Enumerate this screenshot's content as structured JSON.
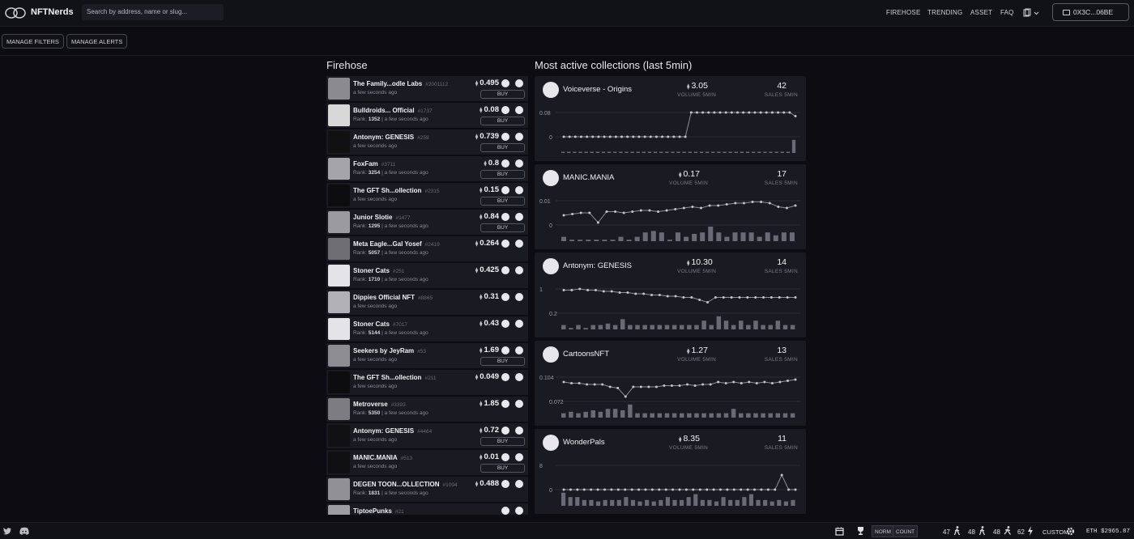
{
  "app": {
    "brand": "NFTNerds"
  },
  "search": {
    "placeholder": "Search by address, name or slug..."
  },
  "nav": {
    "firehose": "FIREHOSE",
    "trending": "TRENDING",
    "asset": "ASSET",
    "faq": "FAQ"
  },
  "wallet": {
    "address": "0X3C...06BE"
  },
  "actions": {
    "manage_filters": "MANAGE FILTERS",
    "manage_alerts": "MANAGE ALERTS"
  },
  "firehose": {
    "title": "Firehose",
    "buy_label": "BUY",
    "rank_prefix": "Rank:",
    "rows": [
      {
        "name": "The Family...odle Labs",
        "id": "#2001112",
        "rank": "",
        "time": "a few seconds ago",
        "price": "0.495",
        "buy": true,
        "thumb": "#8a8a90"
      },
      {
        "name": "Bulldroids... Official",
        "id": "#1737",
        "rank": "1352",
        "time": "a few seconds ago",
        "price": "0.08",
        "buy": true,
        "thumb": "#d8d8d8"
      },
      {
        "name": "Antonym: GENESIS",
        "id": "#258",
        "rank": "",
        "time": "a few seconds ago",
        "price": "0.739",
        "buy": true,
        "thumb": "#111114"
      },
      {
        "name": "FoxFam",
        "id": "#3711",
        "rank": "3254",
        "time": "a few seconds ago",
        "price": "0.8",
        "buy": true,
        "thumb": "#a4a4aa"
      },
      {
        "name": "The GFT Sh...ollection",
        "id": "#2315",
        "rank": "",
        "time": "a few seconds ago",
        "price": "0.15",
        "buy": true,
        "thumb": "#0d0d10"
      },
      {
        "name": "Junior Slotie",
        "id": "#1477",
        "rank": "1295",
        "time": "a few seconds ago",
        "price": "0.84",
        "buy": true,
        "thumb": "#9a9aa0"
      },
      {
        "name": "Meta Eagle...Gal Yosef",
        "id": "#2419",
        "rank": "5057",
        "time": "a few seconds ago",
        "price": "0.264",
        "buy": false,
        "thumb": "#6e6e74"
      },
      {
        "name": "Stoner Cats",
        "id": "#251",
        "rank": "1710",
        "time": "a few seconds ago",
        "price": "0.425",
        "buy": false,
        "thumb": "#e4e4e8"
      },
      {
        "name": "Dippies Official NFT",
        "id": "#8865",
        "rank": "",
        "time": "a few seconds ago",
        "price": "0.31",
        "buy": false,
        "thumb": "#b0b0b6"
      },
      {
        "name": "Stoner Cats",
        "id": "#7017",
        "rank": "5144",
        "time": "a few seconds ago",
        "price": "0.43",
        "buy": false,
        "thumb": "#e4e4e8"
      },
      {
        "name": "Seekers by JeyRam",
        "id": "#53",
        "rank": "",
        "time": "a few seconds ago",
        "price": "1.69",
        "buy": true,
        "thumb": "#8c8c92"
      },
      {
        "name": "The GFT Sh...ollection",
        "id": "#211",
        "rank": "",
        "time": "a few seconds ago",
        "price": "0.049",
        "buy": false,
        "thumb": "#0d0d10"
      },
      {
        "name": "Metroverse",
        "id": "#3393",
        "rank": "5350",
        "time": "a few seconds ago",
        "price": "1.85",
        "buy": false,
        "thumb": "#7c7c82"
      },
      {
        "name": "Antonym: GENESIS",
        "id": "#4464",
        "rank": "",
        "time": "a few seconds ago",
        "price": "0.72",
        "buy": true,
        "thumb": "#111114"
      },
      {
        "name": "MANIC.MANIA",
        "id": "#513",
        "rank": "",
        "time": "a few seconds ago",
        "price": "0.01",
        "buy": true,
        "thumb": "#0f0f12"
      },
      {
        "name": "DEGEN TOON...OLLECTION",
        "id": "#1094",
        "rank": "1831",
        "time": "a few seconds ago",
        "price": "0.488",
        "buy": false,
        "thumb": "#909096"
      },
      {
        "name": "TiptoePunks",
        "id": "#21",
        "rank": "",
        "time": "",
        "price": "",
        "buy": false,
        "thumb": "#9c9ca2"
      }
    ]
  },
  "collections": {
    "title": "Most active collections (last 5min)",
    "volume_label": "VOLUME 5MIN",
    "sales_label": "SALES 5MIN",
    "cards": [
      {
        "name": "Voiceverse - Origins",
        "volume": "3.05",
        "sales": "42",
        "ytop": "0.08",
        "ybottom": "0",
        "line": [
          0,
          0,
          0,
          0,
          0,
          0,
          0,
          0,
          0,
          0,
          0,
          0,
          0,
          0,
          0,
          0,
          0,
          0,
          0,
          0,
          0,
          0,
          1,
          1,
          1,
          1,
          1,
          1,
          1,
          1,
          1,
          1,
          1,
          1,
          1,
          1,
          1,
          1,
          1,
          1,
          0.85
        ],
        "bars": [
          0.05,
          0.05,
          0.05,
          0.05,
          0.05,
          0.05,
          0.05,
          0.05,
          0.05,
          0.05,
          0.05,
          0.05,
          0.05,
          0.05,
          0.05,
          0.05,
          0.05,
          0.05,
          0.05,
          0.05,
          0.05,
          0.05,
          0.05,
          0.05,
          0.05,
          0.05,
          0.05,
          0.05,
          0.05,
          0.05,
          0.05,
          0.05,
          0.05,
          0.05,
          0.05,
          0.05,
          0.05,
          0.05,
          0.05,
          0.05,
          0.9
        ]
      },
      {
        "name": "MANIC.MANIA",
        "volume": "0.17",
        "sales": "17",
        "ytop": "0.01",
        "ybottom": "0",
        "line": [
          0.4,
          0.45,
          0.5,
          0.5,
          0.1,
          0.55,
          0.55,
          0.5,
          0.55,
          0.6,
          0.6,
          0.55,
          0.6,
          0.65,
          0.7,
          0.75,
          0.7,
          0.8,
          0.8,
          0.85,
          0.9,
          0.9,
          0.95,
          0.95,
          0.9,
          0.75,
          0.7,
          0.8
        ],
        "bars": [
          0.3,
          0.1,
          0.1,
          0.1,
          0.1,
          0.1,
          0.1,
          0.3,
          0.1,
          0.3,
          0.6,
          0.7,
          0.6,
          0.1,
          0.6,
          0.3,
          0.5,
          0.6,
          1.0,
          0.6,
          0.3,
          0.6,
          0.6,
          0.6,
          0.3,
          0.6,
          0.4,
          0.6,
          0.6
        ]
      },
      {
        "name": "Antonym: GENESIS",
        "volume": "10.30",
        "sales": "14",
        "ytop": "1",
        "ybottom": "0.2",
        "line": [
          0.95,
          0.95,
          1.0,
          0.95,
          0.95,
          0.9,
          0.9,
          0.85,
          0.85,
          0.8,
          0.8,
          0.75,
          0.75,
          0.7,
          0.7,
          0.65,
          0.65,
          0.55,
          0.45,
          0.65,
          0.65,
          0.65,
          0.65,
          0.65,
          0.65,
          0.65,
          0.65,
          0.65,
          0.65,
          0.65
        ],
        "bars": [
          0.3,
          0.1,
          0.3,
          0.1,
          0.3,
          0.3,
          0.4,
          0.3,
          0.7,
          0.3,
          0.3,
          0.3,
          0.3,
          0.3,
          0.3,
          0.3,
          0.3,
          0.3,
          0.3,
          0.6,
          0.3,
          0.9,
          0.6,
          0.3,
          0.6,
          0.3,
          0.6,
          0.3,
          0.3,
          0.6,
          0.3,
          0.3
        ]
      },
      {
        "name": "CartoonsNFT",
        "volume": "1.27",
        "sales": "13",
        "ytop": "0.104",
        "ybottom": "0.072",
        "line": [
          0.8,
          0.75,
          0.75,
          0.7,
          0.7,
          0.7,
          0.6,
          0.55,
          0.2,
          0.6,
          0.6,
          0.6,
          0.6,
          0.65,
          0.65,
          0.65,
          0.7,
          0.65,
          0.7,
          0.7,
          0.8,
          0.75,
          0.8,
          0.75,
          0.8,
          0.75,
          0.8,
          0.75,
          0.8,
          0.85,
          0.9
        ],
        "bars": [
          0.3,
          0.4,
          0.3,
          0.4,
          0.5,
          0.4,
          0.6,
          0.6,
          0.5,
          0.9,
          0.3,
          0.3,
          0.3,
          0.3,
          0.3,
          0.3,
          0.3,
          0.3,
          0.3,
          0.3,
          0.3,
          0.3,
          0.3,
          0.6,
          0.3,
          0.3,
          0.3,
          0.3,
          0.3,
          0.3,
          0.3,
          0.3
        ]
      },
      {
        "name": "WonderPals",
        "volume": "8.35",
        "sales": "11",
        "ytop": "8",
        "ybottom": "0",
        "line": [
          0,
          0,
          0,
          0,
          0,
          0,
          0,
          0,
          0,
          0,
          0,
          0,
          0,
          0,
          0,
          0,
          0,
          0,
          0,
          0,
          0,
          0,
          0,
          0,
          0,
          0,
          0,
          0,
          0,
          0,
          0,
          0,
          0.6,
          0,
          0
        ],
        "bars": [
          0.9,
          0.6,
          0.6,
          0.4,
          0.4,
          0.3,
          0.4,
          0.4,
          0.4,
          0.6,
          0.4,
          0.3,
          0.4,
          0.3,
          0.4,
          0.6,
          0.4,
          0.4,
          0.6,
          0.8,
          0.4,
          0.4,
          0.3,
          0.6,
          0.4,
          0.4,
          0.6,
          0.8,
          0.4,
          0.4,
          0.3,
          0.4,
          0.3,
          0.4
        ]
      }
    ]
  },
  "footer": {
    "norm": "NORM",
    "count": "COUNT",
    "stat1": "47",
    "stat2": "48",
    "stat3": "48",
    "stat4": "62",
    "custom": "CUSTOM",
    "eth_price": "ETH $2965.87"
  }
}
